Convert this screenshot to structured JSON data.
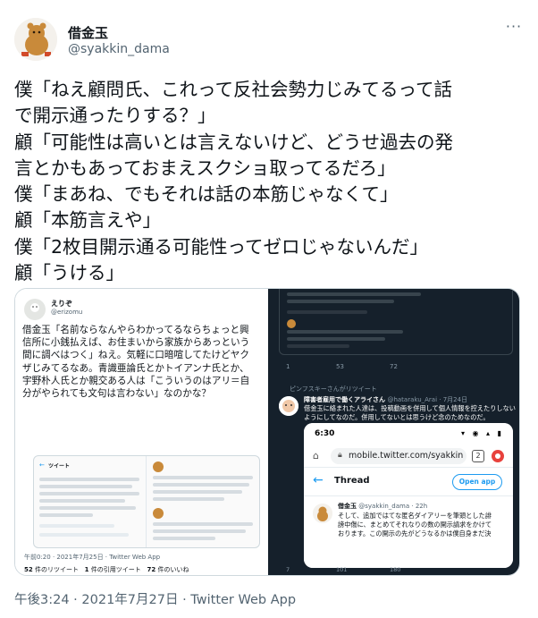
{
  "author": {
    "name": "借金玉",
    "handle": "@syakkin_dama"
  },
  "tweet": {
    "lines": [
      "僕「ねえ顧問氏、これって反社会勢力じみてるって話",
      "で開示通ったりする？」",
      "顧「可能性は高いとは言えないけど、どうせ過去の発",
      "言とかもあっておまえスクショ取ってるだろ」",
      "僕「まあね、でもそれは話の本筋じゃなくて」",
      "顧「本筋言えや」",
      "僕「2枚目開示通る可能性ってゼロじゃないんだ」",
      "顧「うける」"
    ],
    "timestamp": "午後3:24 · 2021年7月27日 · Twitter Web App"
  },
  "media_left": {
    "name": "えりぞ",
    "handle": "@erizomu",
    "text_lines": [
      "借金玉「名前ならなんやらわかってるならちょっと興",
      "信所に小銭払えば、お住まいから家族からあっという",
      "間に調べはつく」ねえ。気軽に口暗喧してたけどヤク",
      "ザじみてるなあ。青識亜論氏とかトイアンナ氏とか、",
      "宇野朴人氏とか親交ある人は「こういうのはアリ＝自",
      "分がやられても文句は言わない」なのかな？"
    ],
    "inner_header": "ツイート",
    "time": "午前0:20 · 2021年7月25日 · Twitter Web App",
    "retweets_label": "件のリツイート",
    "retweets": "52",
    "quotes_label": "件の引用ツイート",
    "quotes": "1",
    "likes_label": "件のいいね",
    "likes": "72"
  },
  "media_right": {
    "retweet_label": "ピンフスキーさんがリツイート",
    "action_counts": [
      "1",
      "53",
      "72"
    ],
    "rt_name": "障害者雇用で働くアライさん",
    "rt_handle": "@hataraku_Arai · 7月24日",
    "rt_text_lines": [
      "借金玉に絡まれた人達は、投稿動画を併用して個人情報を控えたりしない",
      "ようにしてなのだ。併用してないとは思うけど念のためなのだ。"
    ],
    "phone": {
      "time": "6:30",
      "url": "mobile.twitter.com/syakkin",
      "tab_count": "2",
      "thread_title": "Thread",
      "open_app": "Open app",
      "author": "借金玉",
      "author_meta": "@syakkin_dama · 22h",
      "text_lines": [
        "そして、追加ではてな匿名ダイアリーを筆頭とした誹",
        "謗中傷に、まとめてそれなりの数の開示請求をかけて",
        "おります。この開示の先がどうなるかは僕自身まだ決"
      ]
    },
    "bottom_counts": [
      "7",
      "101",
      "180"
    ]
  }
}
